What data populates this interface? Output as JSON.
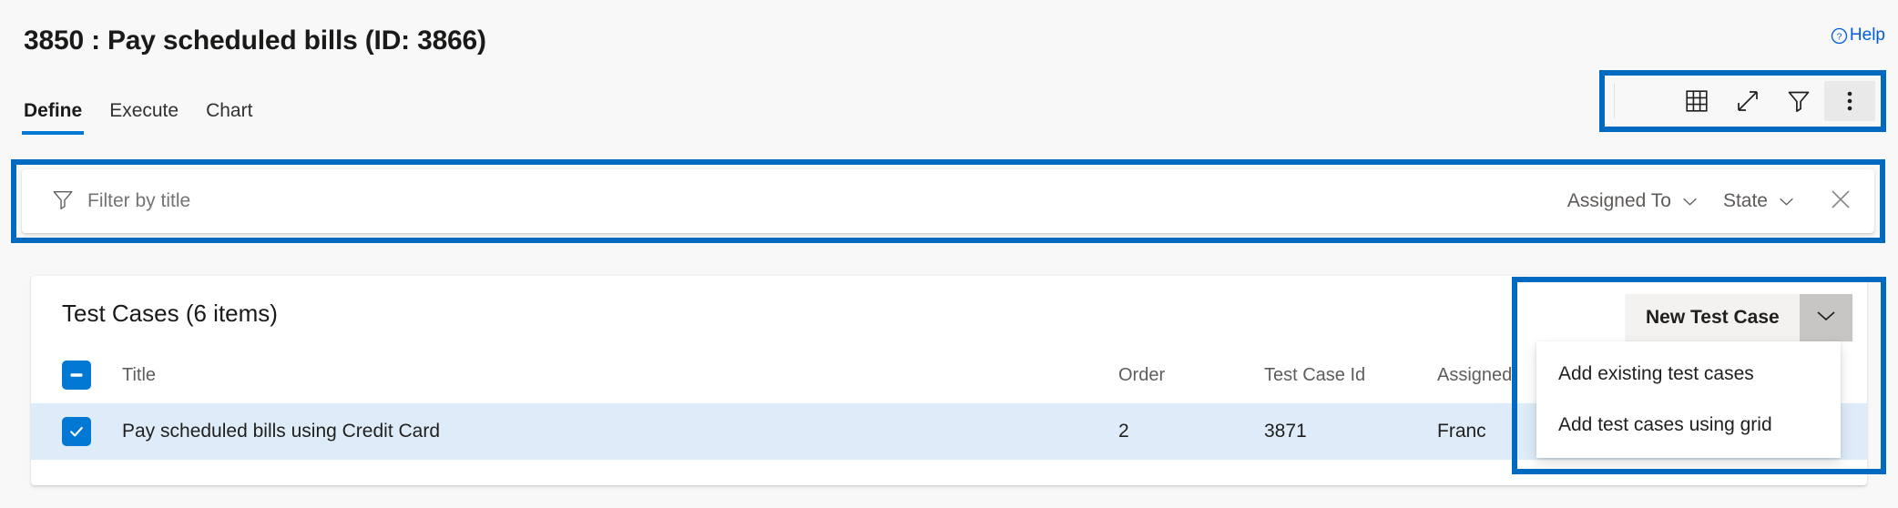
{
  "header": {
    "title": "3850 : Pay scheduled bills (ID: 3866)",
    "help_label": "Help",
    "help_icon": "question-circle-icon"
  },
  "tabs": [
    {
      "label": "Define",
      "active": true
    },
    {
      "label": "Execute",
      "active": false
    },
    {
      "label": "Chart",
      "active": false
    }
  ],
  "toolbar": {
    "buttons": [
      {
        "name": "grid-view-button",
        "icon": "grid-icon"
      },
      {
        "name": "fullscreen-button",
        "icon": "expand-diagonal-icon"
      },
      {
        "name": "filter-button",
        "icon": "funnel-icon"
      },
      {
        "name": "more-options-button",
        "icon": "more-vertical-icon"
      }
    ]
  },
  "filter": {
    "placeholder": "Filter by title",
    "value": "",
    "icon": "funnel-icon",
    "assigned_to_label": "Assigned To",
    "state_label": "State",
    "close_icon": "close-icon"
  },
  "card": {
    "title": "Test Cases (6 items)",
    "columns": {
      "select": "",
      "title": "Title",
      "order": "Order",
      "test_case_id": "Test Case Id",
      "assigned_to": "Assigned"
    },
    "rows": [
      {
        "selected": true,
        "title": "Pay scheduled bills using Credit Card",
        "order": "2",
        "test_case_id": "3871",
        "assigned_to": "Franc"
      }
    ],
    "header_checkbox_state": "indeterminate"
  },
  "new_test_case": {
    "button_label": "New Test Case",
    "chevron_icon": "chevron-down-icon",
    "menu_items": [
      {
        "label": "Add existing test cases"
      },
      {
        "label": "Add test cases using grid"
      }
    ]
  },
  "colors": {
    "accent": "#0078d4",
    "highlight_box": "#0069c0",
    "row_selected": "#deecf9",
    "page_bg": "#f8f8f8"
  }
}
